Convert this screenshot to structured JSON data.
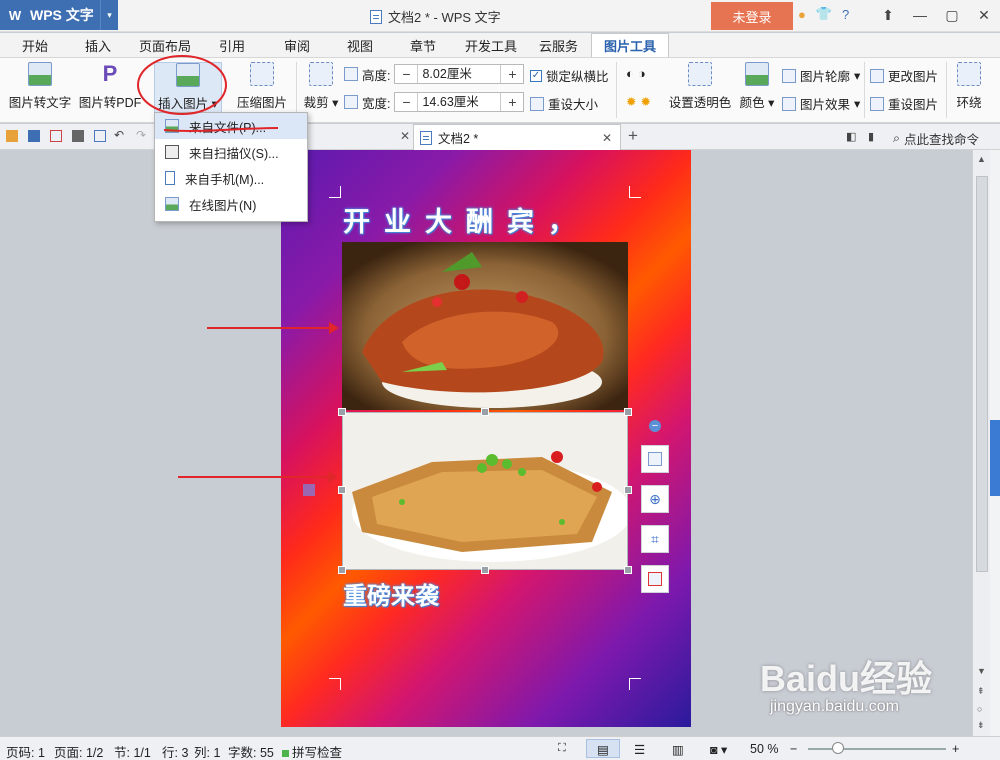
{
  "titlebar": {
    "app_name": "WPS 文字",
    "window_title": "文档2 * - WPS 文字",
    "login_label": "未登录"
  },
  "menu_tabs": [
    "开始",
    "插入",
    "页面布局",
    "引用",
    "审阅",
    "视图",
    "章节",
    "开发工具",
    "云服务",
    "图片工具"
  ],
  "ribbon": {
    "pic_to_text": "图片转文字",
    "pic_to_pdf": "图片转PDF",
    "insert_picture": "插入图片",
    "compress_picture": "压缩图片",
    "crop": "裁剪",
    "height_label": "高度:",
    "height_value": "8.02厘米",
    "width_label": "宽度:",
    "width_value": "14.63厘米",
    "lock_ratio": "锁定纵横比",
    "reset_size": "重设大小",
    "set_transparent": "设置透明色",
    "color": "颜色",
    "pic_outline": "图片轮廓",
    "pic_effect": "图片效果",
    "change_picture": "更改图片",
    "reset_picture": "重设图片",
    "wrap": "环绕"
  },
  "dropdown": {
    "items": [
      "来自文件(P)...",
      "来自扫描仪(S)...",
      "来自手机(M)...",
      "在线图片(N)"
    ]
  },
  "doc_tab": {
    "name": "文档2 *",
    "search_cmd": "点此查找命令"
  },
  "document": {
    "title_text": "开业大酬宾，",
    "subtitle_text": "重磅来袭"
  },
  "statusbar": {
    "page_no": "页码: 1",
    "page": "页面: 1/2",
    "section": "节: 1/1",
    "row": "行: 3",
    "col": "列: 1",
    "words": "字数: 55",
    "spell": "拼写检查",
    "zoom": "50 %"
  },
  "watermark": {
    "logo": "Baidu经验",
    "sub": "jingyan.baidu.com"
  },
  "colors": {
    "accent": "#3f6fb3",
    "login": "#e67352",
    "annotation": "#e0262a"
  }
}
